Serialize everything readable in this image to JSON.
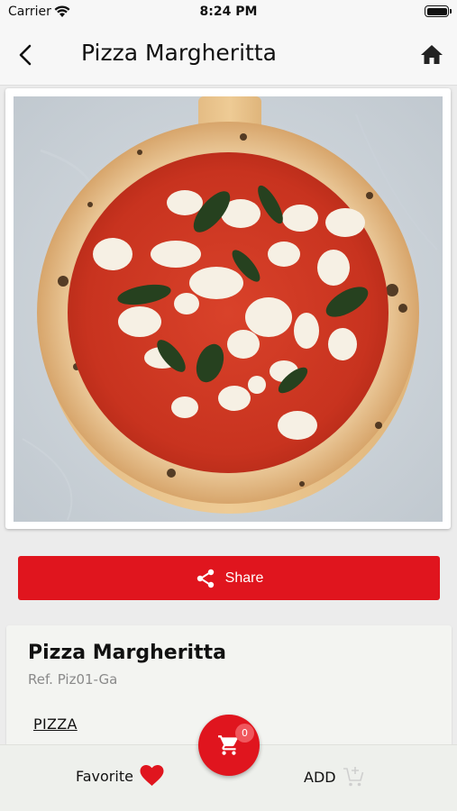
{
  "status_bar": {
    "carrier": "Carrier",
    "time": "8:24 PM",
    "icons": [
      "wifi-icon",
      "battery-icon"
    ]
  },
  "nav": {
    "title": "Pizza Margheritta",
    "back_icon": "chevron-left-icon",
    "home_icon": "home-icon"
  },
  "product": {
    "image": "pizza margherita photo",
    "name": "Pizza Margheritta",
    "ref": "Ref. Piz01-Ga",
    "category": "PIZZA"
  },
  "share": {
    "label": "Share",
    "icon": "share-icon"
  },
  "bottom_bar": {
    "favorite_label": "Favorite",
    "favorite_icon": "heart-icon",
    "add_label": "ADD",
    "add_icon": "cart-add-icon",
    "cart_count": "0",
    "cart_icon": "cart-icon"
  },
  "colors": {
    "accent": "#e0151e",
    "badge": "#f0575d",
    "header_bg": "#f7f7f7",
    "page_bg": "#ececec"
  }
}
